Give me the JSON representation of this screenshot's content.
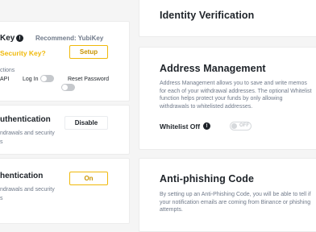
{
  "yubikey": {
    "title_fragment": "Key",
    "recommend": "Recommend: YubiKey",
    "link_fragment": "Security Key?",
    "setup_label": "Setup",
    "sub_fragment": "ctions",
    "actions": [
      {
        "label": "API"
      },
      {
        "label": "Log In"
      },
      {
        "label": "Reset Password"
      }
    ]
  },
  "twofa_1": {
    "title_fragment": "uthentication",
    "desc_lines": [
      "ndrawals and security",
      "s"
    ],
    "button_label": "Disable"
  },
  "twofa_2": {
    "title_fragment": "hentication",
    "desc_lines": [
      "ndrawals and security",
      "s"
    ],
    "button_label": "On"
  },
  "identity": {
    "title": "Identity Verification"
  },
  "address": {
    "title": "Address Management",
    "desc_lines": [
      "Address Management allows you to save and write memos",
      "for each of your withdrawal addresses. The optional Whitelist",
      "function helps protect your funds by only allowing",
      "withdrawals to whitelisted addresses."
    ],
    "whitelist_label": "Whitelist Off",
    "whitelist_toggle": "OFF"
  },
  "antiphishing": {
    "title": "Anti-phishing Code",
    "desc_lines": [
      "By setting up an Anti-Phishing Code, you will be able to tell if",
      "your notification emails are coming from Binance or phishing",
      "attempts."
    ]
  },
  "colors": {
    "accent": "#f0b90b",
    "accent_text": "#c99400",
    "text": "#1e2329",
    "muted": "#707a8a",
    "background": "#f5f5f5"
  }
}
